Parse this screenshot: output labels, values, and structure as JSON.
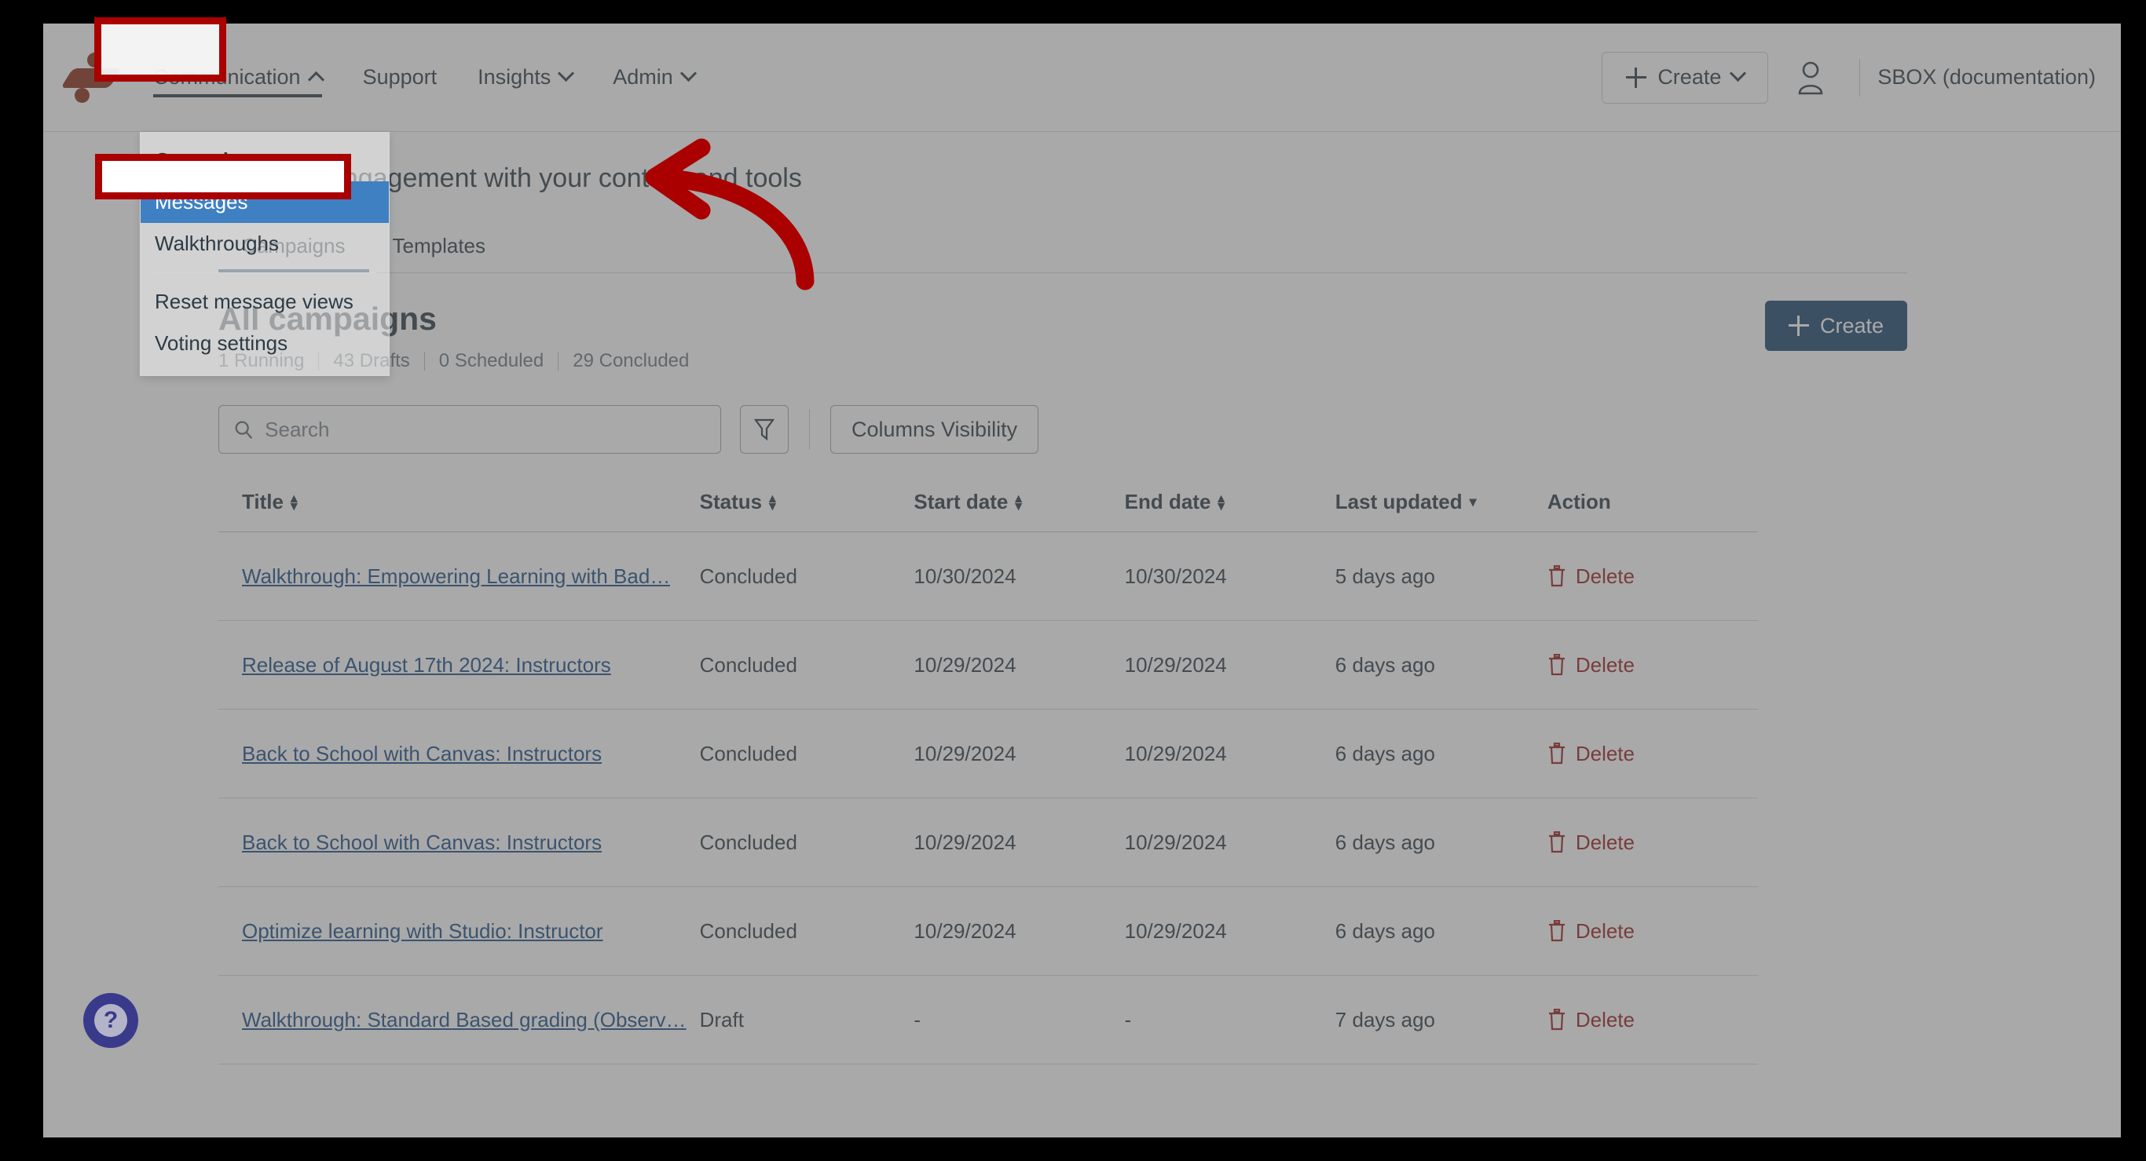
{
  "topnav": {
    "logo_name": "impact-logo",
    "items": [
      {
        "label": "Communication",
        "has_chevron": true,
        "chevron": "up",
        "active": true,
        "highlighted": true
      },
      {
        "label": "Support",
        "has_chevron": false,
        "chevron": "",
        "active": false,
        "highlighted": false
      },
      {
        "label": "Insights",
        "has_chevron": true,
        "chevron": "down",
        "active": false,
        "highlighted": false
      },
      {
        "label": "Admin",
        "has_chevron": true,
        "chevron": "down",
        "active": false,
        "highlighted": false
      }
    ],
    "create_label": "Create",
    "account_label": "SBOX (documentation)",
    "person_icon": "person-icon",
    "plus_icon": "plus-icon",
    "chevron_down_icon": "chevron-down-icon",
    "chevron_up_icon": "chevron-up-icon"
  },
  "dropdown": {
    "open_for": "Communication",
    "items": [
      {
        "label": "Campaigns",
        "bold": true,
        "selected": false,
        "separator_after": false
      },
      {
        "label": "Messages",
        "bold": false,
        "selected": true,
        "separator_after": false
      },
      {
        "label": "Walkthroughs",
        "bold": false,
        "selected": false,
        "separator_after": true
      },
      {
        "label": "Reset message views",
        "bold": false,
        "selected": false,
        "separator_after": false
      },
      {
        "label": "Voting settings",
        "bold": false,
        "selected": false,
        "separator_after": false
      }
    ]
  },
  "hero": {
    "subtitle": "enhance engagement with your content and tools"
  },
  "tabs": [
    {
      "label": "Campaigns",
      "active": true
    },
    {
      "label": "Templates",
      "active": false
    }
  ],
  "panel": {
    "title": "All campaigns",
    "counts": [
      "1 Running",
      "43 Drafts",
      "0 Scheduled",
      "29 Concluded"
    ],
    "create_label": "Create"
  },
  "toolbar": {
    "search_placeholder": "Search",
    "search_value": "",
    "search_icon": "search-icon",
    "filter_icon": "filter-icon",
    "columns_label": "Columns Visibility"
  },
  "table": {
    "columns": [
      {
        "label": "Title",
        "sort": "both"
      },
      {
        "label": "Status",
        "sort": "both"
      },
      {
        "label": "Start date",
        "sort": "both"
      },
      {
        "label": "End date",
        "sort": "both"
      },
      {
        "label": "Last updated",
        "sort": "desc"
      },
      {
        "label": "Action",
        "sort": "none"
      }
    ],
    "rows": [
      {
        "title": "Walkthrough: Empowering Learning with Bad…",
        "status": "Concluded",
        "start": "10/30/2024",
        "end": "10/30/2024",
        "updated": "5 days ago",
        "action": "Delete"
      },
      {
        "title": "Release of August 17th 2024: Instructors",
        "status": "Concluded",
        "start": "10/29/2024",
        "end": "10/29/2024",
        "updated": "6 days ago",
        "action": "Delete"
      },
      {
        "title": "Back to School with Canvas: Instructors",
        "status": "Concluded",
        "start": "10/29/2024",
        "end": "10/29/2024",
        "updated": "6 days ago",
        "action": "Delete"
      },
      {
        "title": "Back to School with Canvas: Instructors",
        "status": "Concluded",
        "start": "10/29/2024",
        "end": "10/29/2024",
        "updated": "6 days ago",
        "action": "Delete"
      },
      {
        "title": "Optimize learning with Studio: Instructor",
        "status": "Concluded",
        "start": "10/29/2024",
        "end": "10/29/2024",
        "updated": "6 days ago",
        "action": "Delete"
      },
      {
        "title": "Walkthrough: Standard Based grading (Observ…",
        "status": "Draft",
        "start": "-",
        "end": "-",
        "updated": "7 days ago",
        "action": "Delete"
      }
    ]
  },
  "help": {
    "label": "?"
  },
  "annotations": {
    "highlight_boxes": [
      "Communication nav item",
      "Messages menu item"
    ],
    "arrow": "curved-arrow-pointing-left-to-messages",
    "color": "#aa0000"
  },
  "colors": {
    "annotation_red": "#aa0000",
    "menu_selected_blue": "#3e80c2",
    "create_button_navy": "#1c4570",
    "link_blue": "#1b4d86",
    "delete_red": "#9b1c1c",
    "tab_underline": "#234872",
    "logo_rust": "#8b2c18",
    "help_fab_purple": "#3a3a8c"
  }
}
